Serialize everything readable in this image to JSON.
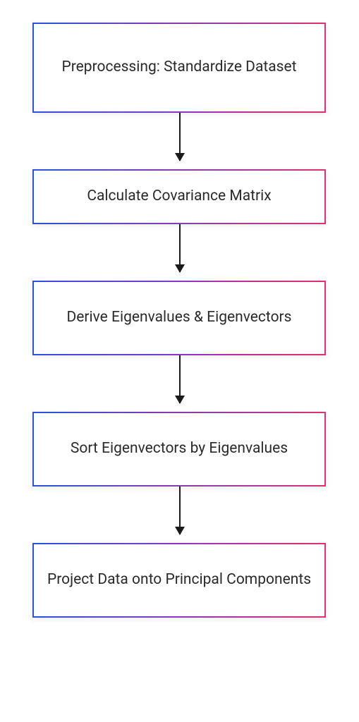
{
  "flowchart": {
    "steps": [
      {
        "label": "Preprocessing: Standardize Dataset"
      },
      {
        "label": "Calculate Covariance Matrix"
      },
      {
        "label": "Derive Eigenvalues & Eigenvectors"
      },
      {
        "label": "Sort Eigenvectors by Eigenvalues"
      },
      {
        "label": "Project Data onto Principal Components"
      }
    ]
  },
  "colors": {
    "gradient_start": "#2952e3",
    "gradient_mid": "#8a3ab9",
    "gradient_end": "#e1306c",
    "arrow": "#1a1a1a",
    "text": "#2a2a2a"
  }
}
